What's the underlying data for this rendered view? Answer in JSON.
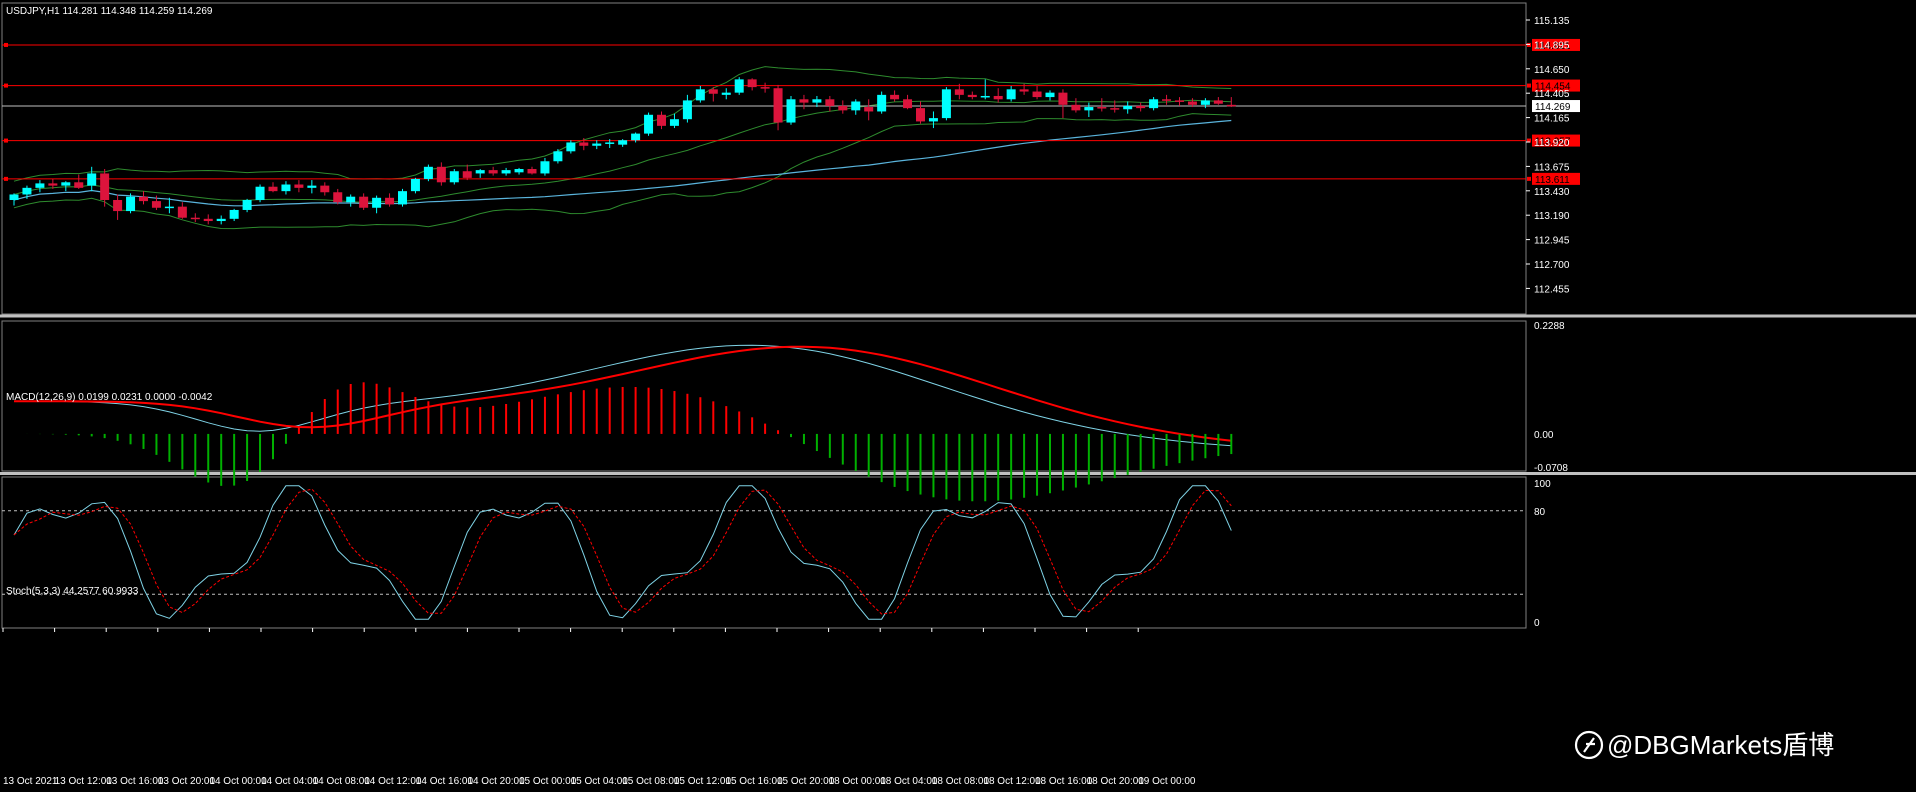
{
  "main_header": "USDJPY,H1  114.281 114.348 114.259 114.269",
  "macd_header": "MACD(12,26,9) 0.0199 0.0231 0.0000 -0.0042",
  "stoch_header": "Stoch(5,3,3) 44.2577 60.9933",
  "watermark": "@DBGMarkets盾博",
  "colors": {
    "background": "#000000",
    "bull_candle": "#00ffff",
    "bear_candle": "#dc143c",
    "bollinger": "#2e8b2e",
    "ma_line": "#5ab4dc",
    "level_line": "#ff0000",
    "macd_main": "#7fd3e6",
    "macd_signal": "#ff0000",
    "hist_pos": "#ff0000",
    "hist_neg": "#00b000",
    "stoch_main": "#7fd3e6",
    "stoch_signal": "#ff0000"
  },
  "main_axis_labels": [
    "115.135",
    "114.895",
    "114.650",
    "114.405",
    "114.165",
    "113.920",
    "113.675",
    "113.430",
    "113.190",
    "112.945",
    "112.700",
    "112.455"
  ],
  "macd_axis_labels": [
    "0.2288",
    "0.00",
    "-0.0708"
  ],
  "stoch_axis_labels": [
    "100",
    "80",
    "0"
  ],
  "time_labels": [
    "13 Oct 2021",
    "13 Oct 12:00",
    "13 Oct 16:00",
    "13 Oct 20:00",
    "14 Oct 00:00",
    "14 Oct 04:00",
    "14 Oct 08:00",
    "14 Oct 12:00",
    "14 Oct 16:00",
    "14 Oct 20:00",
    "15 Oct 00:00",
    "15 Oct 04:00",
    "15 Oct 08:00",
    "15 Oct 12:00",
    "15 Oct 16:00",
    "15 Oct 20:00",
    "18 Oct 00:00",
    "18 Oct 04:00",
    "18 Oct 08:00",
    "18 Oct 12:00",
    "18 Oct 16:00",
    "18 Oct 20:00",
    "19 Oct 00:00"
  ],
  "price_levels": [
    {
      "price": 114.821,
      "label": "114.821"
    },
    {
      "price": 114.454,
      "label": "114.454"
    },
    {
      "price": 113.957,
      "label": "113.957"
    },
    {
      "price": 113.611,
      "label": "113.611"
    }
  ],
  "current_price": {
    "price": 114.269,
    "label": "114.269"
  },
  "chart_data": {
    "type": "candlestick",
    "symbol": "USDJPY",
    "timeframe": "H1",
    "ylim": [
      112.39,
      115.2
    ],
    "candles": [
      [
        113.42,
        113.48,
        113.37,
        113.47
      ],
      [
        113.47,
        113.55,
        113.43,
        113.53
      ],
      [
        113.53,
        113.6,
        113.49,
        113.57
      ],
      [
        113.57,
        113.61,
        113.52,
        113.55
      ],
      [
        113.55,
        113.59,
        113.5,
        113.58
      ],
      [
        113.58,
        113.65,
        113.52,
        113.53
      ],
      [
        113.55,
        113.72,
        113.5,
        113.66
      ],
      [
        113.66,
        113.7,
        113.36,
        113.42
      ],
      [
        113.42,
        113.47,
        113.24,
        113.32
      ],
      [
        113.32,
        113.48,
        113.3,
        113.45
      ],
      [
        113.45,
        113.5,
        113.38,
        113.41
      ],
      [
        113.41,
        113.46,
        113.33,
        113.35
      ],
      [
        113.35,
        113.44,
        113.3,
        113.36
      ],
      [
        113.36,
        113.4,
        113.25,
        113.26
      ],
      [
        113.26,
        113.3,
        113.22,
        113.25
      ],
      [
        113.25,
        113.29,
        113.2,
        113.23
      ],
      [
        113.23,
        113.28,
        113.2,
        113.25
      ],
      [
        113.25,
        113.34,
        113.23,
        113.33
      ],
      [
        113.33,
        113.43,
        113.31,
        113.42
      ],
      [
        113.42,
        113.56,
        113.4,
        113.54
      ],
      [
        113.54,
        113.58,
        113.49,
        113.5
      ],
      [
        113.5,
        113.59,
        113.47,
        113.56
      ],
      [
        113.56,
        113.6,
        113.49,
        113.53
      ],
      [
        113.53,
        113.6,
        113.48,
        113.55
      ],
      [
        113.55,
        113.58,
        113.46,
        113.49
      ],
      [
        113.49,
        113.52,
        113.38,
        113.4
      ],
      [
        113.4,
        113.47,
        113.36,
        113.45
      ],
      [
        113.45,
        113.48,
        113.33,
        113.35
      ],
      [
        113.35,
        113.46,
        113.3,
        113.44
      ],
      [
        113.44,
        113.48,
        113.36,
        113.38
      ],
      [
        113.38,
        113.52,
        113.36,
        113.5
      ],
      [
        113.5,
        113.62,
        113.48,
        113.61
      ],
      [
        113.61,
        113.74,
        113.59,
        113.72
      ],
      [
        113.72,
        113.76,
        113.55,
        113.58
      ],
      [
        113.58,
        113.7,
        113.56,
        113.68
      ],
      [
        113.68,
        113.74,
        113.6,
        113.62
      ],
      [
        113.66,
        113.7,
        113.62,
        113.69
      ],
      [
        113.69,
        113.72,
        113.64,
        113.66
      ],
      [
        113.66,
        113.71,
        113.64,
        113.69
      ],
      [
        113.67,
        113.71,
        113.65,
        113.7
      ],
      [
        113.7,
        113.72,
        113.65,
        113.66
      ],
      [
        113.66,
        113.8,
        113.64,
        113.77
      ],
      [
        113.77,
        113.88,
        113.75,
        113.86
      ],
      [
        113.86,
        113.96,
        113.84,
        113.94
      ],
      [
        113.94,
        113.98,
        113.87,
        113.91
      ],
      [
        113.91,
        113.96,
        113.88,
        113.93
      ],
      [
        113.93,
        113.97,
        113.89,
        113.94
      ],
      [
        113.92,
        113.97,
        113.9,
        113.96
      ],
      [
        113.96,
        114.03,
        113.94,
        114.02
      ],
      [
        114.02,
        114.21,
        114.0,
        114.19
      ],
      [
        114.19,
        114.22,
        114.06,
        114.09
      ],
      [
        114.09,
        114.2,
        114.07,
        114.15
      ],
      [
        114.15,
        114.37,
        114.12,
        114.32
      ],
      [
        114.32,
        114.45,
        114.3,
        114.42
      ],
      [
        114.42,
        114.44,
        114.31,
        114.38
      ],
      [
        114.37,
        114.43,
        114.33,
        114.39
      ],
      [
        114.39,
        114.53,
        114.37,
        114.51
      ],
      [
        114.51,
        114.52,
        114.41,
        114.44
      ],
      [
        114.44,
        114.48,
        114.39,
        114.43
      ],
      [
        114.43,
        114.46,
        114.05,
        114.12
      ],
      [
        114.12,
        114.36,
        114.1,
        114.33
      ],
      [
        114.33,
        114.37,
        114.24,
        114.3
      ],
      [
        114.3,
        114.36,
        114.26,
        114.33
      ],
      [
        114.33,
        114.36,
        114.22,
        114.27
      ],
      [
        114.27,
        114.32,
        114.2,
        114.23
      ],
      [
        114.23,
        114.33,
        114.19,
        114.31
      ],
      [
        114.26,
        114.33,
        114.14,
        114.22
      ],
      [
        114.22,
        114.4,
        114.2,
        114.37
      ],
      [
        114.37,
        114.41,
        114.31,
        114.33
      ],
      [
        114.33,
        114.37,
        114.24,
        114.25
      ],
      [
        114.25,
        114.31,
        114.11,
        114.13
      ],
      [
        114.13,
        114.22,
        114.07,
        114.16
      ],
      [
        114.16,
        114.44,
        114.14,
        114.42
      ],
      [
        114.42,
        114.47,
        114.33,
        114.37
      ],
      [
        114.37,
        114.4,
        114.33,
        114.35
      ],
      [
        114.35,
        114.51,
        114.33,
        114.36
      ],
      [
        114.36,
        114.43,
        114.3,
        114.33
      ],
      [
        114.33,
        114.45,
        114.31,
        114.42
      ],
      [
        114.42,
        114.47,
        114.37,
        114.4
      ],
      [
        114.4,
        114.45,
        114.33,
        114.35
      ],
      [
        114.35,
        114.41,
        114.32,
        114.39
      ],
      [
        114.39,
        114.42,
        114.16,
        114.28
      ],
      [
        114.28,
        114.34,
        114.21,
        114.23
      ],
      [
        114.23,
        114.3,
        114.17,
        114.26
      ],
      [
        114.26,
        114.34,
        114.22,
        114.25
      ],
      [
        114.25,
        114.32,
        114.21,
        114.24
      ],
      [
        114.24,
        114.31,
        114.2,
        114.27
      ],
      [
        114.27,
        114.3,
        114.22,
        114.25
      ],
      [
        114.25,
        114.35,
        114.23,
        114.33
      ],
      [
        114.33,
        114.37,
        114.28,
        114.32
      ],
      [
        114.32,
        114.35,
        114.27,
        114.31
      ],
      [
        114.31,
        114.34,
        114.26,
        114.28
      ],
      [
        114.28,
        114.34,
        114.25,
        114.32
      ],
      [
        114.32,
        114.35,
        114.28,
        114.29
      ],
      [
        114.28,
        114.35,
        114.26,
        114.27
      ]
    ],
    "indicators": {
      "macd_hist_range": [
        -0.0708,
        0.2288
      ],
      "stoch_range": [
        0,
        100
      ],
      "stoch_levels": [
        20,
        80
      ]
    }
  }
}
